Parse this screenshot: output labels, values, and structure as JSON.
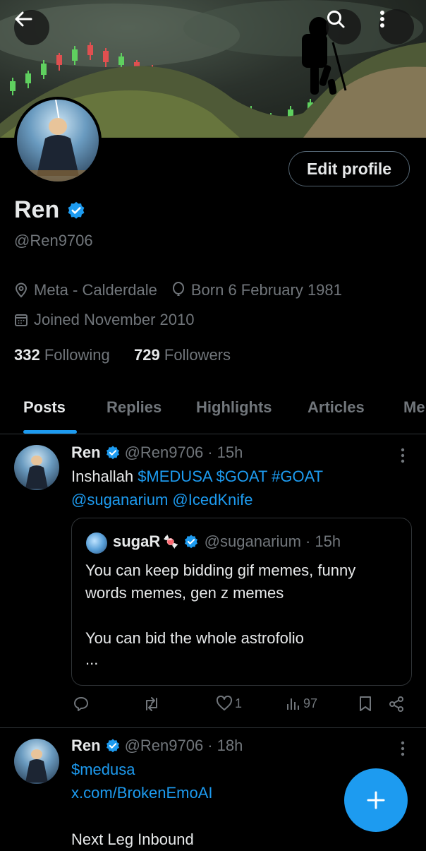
{
  "colors": {
    "accent": "#1d9bf0",
    "background": "#000000",
    "text": "#e7e9ea",
    "muted": "#71767b",
    "border": "#2f3336"
  },
  "header": {
    "back_icon": "arrow-left-icon",
    "search_icon": "search-icon",
    "more_icon": "more-vertical-icon"
  },
  "profile": {
    "edit_label": "Edit profile",
    "name": "Ren",
    "handle": "@Ren9706",
    "location": "Meta - Calderdale",
    "birthday": "Born 6 February 1981",
    "joined": "Joined November 2010",
    "following_count": "332",
    "following_label": "Following",
    "followers_count": "729",
    "followers_label": "Followers"
  },
  "tabs": [
    {
      "label": "Posts"
    },
    {
      "label": "Replies"
    },
    {
      "label": "Highlights"
    },
    {
      "label": "Articles"
    },
    {
      "label": "Me"
    }
  ],
  "posts": [
    {
      "name": "Ren",
      "handle": "@Ren9706",
      "time": "· 15h",
      "text_plain": "Inshallah ",
      "tags": [
        "$MEDUSA",
        "$GOAT",
        "#GOAT"
      ],
      "mentions": [
        "@suganarium",
        "@IcedKnife"
      ],
      "quote": {
        "name": "sugaR",
        "emoji": "🍬",
        "handle": "@suganarium",
        "time": "· 15h",
        "line1": "You can keep bidding gif memes, funny",
        "line2": "words memes, gen z memes",
        "line3": "You can bid the whole astrofolio",
        "line4": "..."
      },
      "likes": "1",
      "views": "97"
    },
    {
      "name": "Ren",
      "handle": "@Ren9706",
      "time": "· 18h",
      "link1": "$medusa",
      "link2": "x.com/BrokenEmoAI",
      "text": "Next Leg Inbound"
    }
  ]
}
